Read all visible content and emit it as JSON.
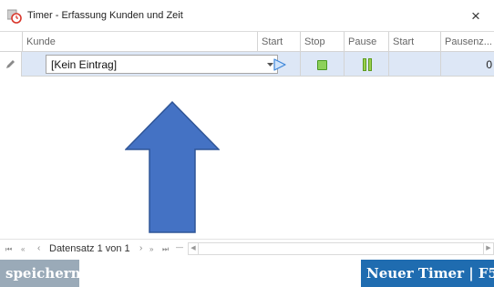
{
  "window": {
    "title": "Timer - Erfassung Kunden und Zeit",
    "close_label": "×"
  },
  "grid": {
    "columns": [
      "Kunde",
      "Start",
      "Stop",
      "Pause",
      "Start",
      "Pausenz..."
    ],
    "row": {
      "kunde": "[Kein Eintrag]",
      "pausenzeit": "0"
    }
  },
  "navigator": {
    "first": "⏮",
    "prev_page": "«",
    "prev": "‹",
    "record_text": "Datensatz 1 von 1",
    "next": "›",
    "next_page": "»",
    "last": "⏭",
    "delete": "—",
    "scroll_left": "◀",
    "scroll_right": "▶"
  },
  "buttons": {
    "save": "speichern",
    "new_timer": "Neuer Timer | F5"
  },
  "colors": {
    "row_highlight": "#dde7f6",
    "arrow_fill": "#4472c4",
    "arrow_stroke": "#2f5597",
    "save_bg": "#9aaab8",
    "new_timer_bg": "#1f6cb0"
  }
}
